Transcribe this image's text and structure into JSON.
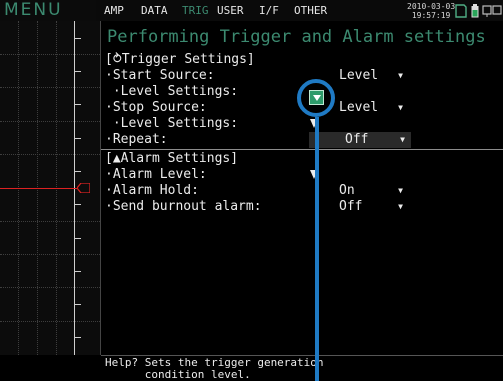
{
  "header": {
    "menu_title": "MENU",
    "tabs": [
      {
        "label": "AMP"
      },
      {
        "label": "DATA"
      },
      {
        "label": "TRIG"
      },
      {
        "label": "USER"
      },
      {
        "label": "I/F"
      },
      {
        "label": "OTHER"
      }
    ],
    "active_tab": "TRIG",
    "date": "2010-03-03",
    "time": "19:57:19",
    "icons": [
      "sd-card-icon",
      "battery-icon",
      "network-icon"
    ]
  },
  "page": {
    "title": "Performing Trigger and Alarm settings"
  },
  "trigger_settings": {
    "heading": "[⥁Trigger Settings]",
    "start_source": {
      "label": "·Start Source:",
      "value": "Level"
    },
    "start_level": {
      "label": " ·Level Settings:"
    },
    "stop_source": {
      "label": "·Stop Source:",
      "value": "Level"
    },
    "stop_level": {
      "label": " ·Level Settings:"
    },
    "repeat": {
      "label": "·Repeat:",
      "value": "Off"
    }
  },
  "alarm_settings": {
    "heading": "[▲Alarm Settings]",
    "alarm_level": {
      "label": "·Alarm Level:"
    },
    "alarm_hold": {
      "label": "·Alarm Hold:",
      "value": "On"
    },
    "burnout": {
      "label": "·Send burnout alarm:",
      "value": "Off"
    }
  },
  "help": {
    "line1": "Help? Sets the trigger generation",
    "line2": "      condition level."
  },
  "colors": {
    "accent": "#3c8a70",
    "callout": "#1f7ac4",
    "trigger_line": "#dd2222"
  }
}
